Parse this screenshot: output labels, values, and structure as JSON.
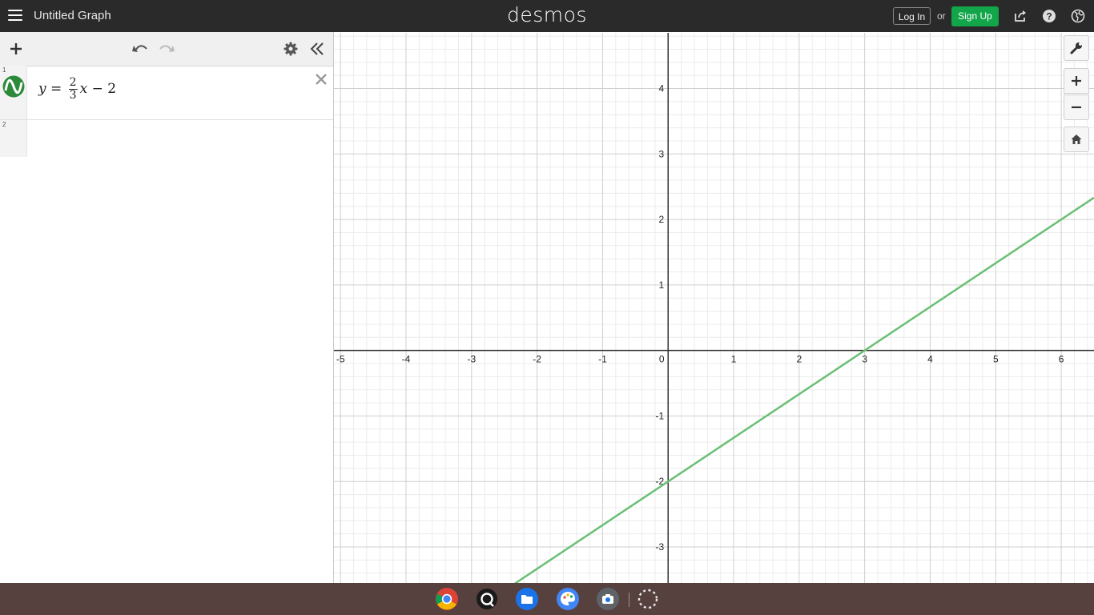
{
  "header": {
    "title": "Untitled Graph",
    "logo": "desmos",
    "login_label": "Log In",
    "or_label": "or",
    "signup_label": "Sign Up",
    "icons": [
      "menu-icon",
      "share-icon",
      "help-icon",
      "globe-icon"
    ]
  },
  "expressions": {
    "toolbar_icons": [
      "add-icon",
      "undo-icon",
      "redo-icon",
      "gear-icon",
      "collapse-icon"
    ],
    "items": [
      {
        "number": "1",
        "latex": "y = \\frac{2}{3}x - 2",
        "parts": {
          "lhs": "y",
          "eq": "=",
          "num": "2",
          "den": "3",
          "var": "x",
          "op": "−",
          "const": "2"
        },
        "color": "#2d8a3a",
        "line_color": "#6abf74"
      },
      {
        "number": "2",
        "latex": ""
      }
    ]
  },
  "graph": {
    "x_ticks": [
      "-5",
      "-4",
      "-3",
      "-2",
      "-1",
      "0",
      "1",
      "2",
      "3",
      "4",
      "5",
      "6"
    ],
    "y_ticks": [
      "4",
      "3",
      "2",
      "1",
      "-1",
      "-2",
      "-3"
    ],
    "xlim": [
      -5.1,
      6.5
    ],
    "ylim": [
      -3.55,
      4.85
    ],
    "grid": true,
    "minor_grid": true,
    "zoom_icons": [
      "wrench-icon",
      "zoom-in-icon",
      "zoom-out-icon",
      "home-icon"
    ]
  },
  "shelf": {
    "apps": [
      "chrome-icon",
      "camera-app-icon",
      "files-icon",
      "palette-icon",
      "screenshot-icon",
      "launcher-icon"
    ]
  }
}
